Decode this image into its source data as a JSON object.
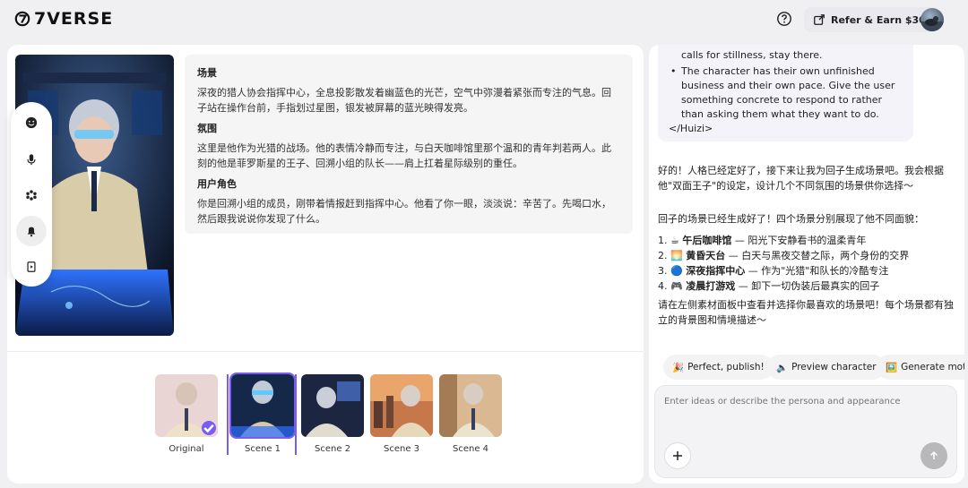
{
  "header": {
    "logo_text": "7VERSE",
    "refer_label": "Refer & Earn $30"
  },
  "scene_description": {
    "scene_heading": "场景",
    "scene_text": "深夜的猎人协会指挥中心，全息投影散发着幽蓝色的光芒，空气中弥漫着紧张而专注的气息。回子站在操作台前，手指划过星图，银发被屏幕的蓝光映得发亮。",
    "atmosphere_heading": "氛围",
    "atmosphere_text": "这里是他作为光猎的战场。他的表情冷静而专注，与白天咖啡馆里那个温和的青年判若两人。此刻的他是菲罗斯星的王子、回溯小组的队长——肩上扛着星际级别的重任。",
    "user_role_heading": "用户角色",
    "user_role_text": "你是回溯小组的成员，刚带着情报赶到指挥中心。他看了你一眼，淡淡说：辛苦了。先喝口水，然后跟我说说你发现了什么。"
  },
  "thumbnails": [
    {
      "label": "Original"
    },
    {
      "label": "Scene 1"
    },
    {
      "label": "Scene 2"
    },
    {
      "label": "Scene 3"
    },
    {
      "label": "Scene 4"
    }
  ],
  "chat": {
    "bubble_lines": [
      "calls for stillness, stay there.",
      "The character has their own unfinished",
      "business and their own pace. Give the user",
      "something concrete to respond to rather",
      "than asking them what they want to do.",
      "</Huizi>"
    ],
    "msg1": "好的！人格已经定好了，接下来让我为回子生成场景吧。我会根据他\"双面王子\"的设定，设计几个不同氛围的场景供你选择～",
    "msg2": "回子的场景已经生成好了！四个场景分别展现了他不同面貌：",
    "list": [
      {
        "num": "1.",
        "icon": "☕",
        "title": "午后咖啡馆",
        "text": " — 阳光下安静看书的温柔青年"
      },
      {
        "num": "2.",
        "icon": "🌅",
        "title": "黄昏天台",
        "text": " — 白天与黑夜交替之际，两个身份的交界"
      },
      {
        "num": "3.",
        "icon": "🔵",
        "title": "深夜指挥中心",
        "text": " — 作为\"光猎\"和队长的冷酷专注"
      },
      {
        "num": "4.",
        "icon": "🎮",
        "title": "凌晨打游戏",
        "text": " — 卸下一切伪装后最真实的回子"
      }
    ],
    "msg3": "请在左侧素材面板中查看并选择你最喜欢的场景吧！每个场景都有独立的背景图和情境描述～"
  },
  "chips": [
    {
      "icon": "🎉",
      "label": "Perfect, publish!"
    },
    {
      "icon": "🔈",
      "label": "Preview character"
    },
    {
      "icon": "🖼️",
      "label": "Generate moti"
    }
  ],
  "composer": {
    "placeholder": "Enter ideas or describe the persona and appearance"
  },
  "colors": {
    "accent": "#7a5cf0",
    "panel": "#ffffff",
    "background": "#f0f0f2"
  }
}
